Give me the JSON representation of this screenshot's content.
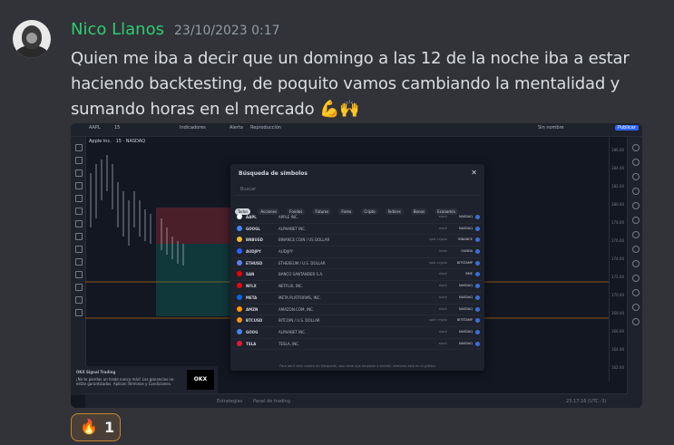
{
  "message": {
    "username": "Nico Llanos",
    "timestamp": "23/10/2023 0:17",
    "text": "Quien me iba a decir que un domingo a las 12 de la noche iba a estar haciendo backtesting, de poquito vamos cambiando la mentalidad y sumando horas en el mercado",
    "emojis": "💪🙌"
  },
  "reaction": {
    "emoji": "🔥",
    "count": "1"
  },
  "screenshot": {
    "toolbar": {
      "symbol": "AAPL",
      "interval": "15",
      "indicators_label": "Indicadores",
      "alert_label": "Alerta",
      "replay_label": "Reproducción",
      "publish_label": "Publicar",
      "unnamed_label": "Sin nombre"
    },
    "chart_title": "Apple Inc. · 15 · NASDAQ",
    "price_levels": [
      "186.00",
      "184.00",
      "182.00",
      "180.00",
      "178.00",
      "176.00",
      "174.00",
      "172.00",
      "170.00",
      "168.00",
      "166.00",
      "164.00",
      "162.00"
    ],
    "fib_labels": [
      "0.618",
      "0.5",
      "0.382",
      "0",
      "1"
    ],
    "time_labels": [
      "4",
      "16",
      "17",
      "18",
      "19",
      "20",
      "24",
      "25",
      "26"
    ],
    "bottom_tabs": [
      "Estrategias",
      "Panel de trading"
    ],
    "bottom_right": "23:17:16 (UTC -3)",
    "ad": {
      "title": "OKX Signal Trading",
      "body": "¡No te pierdas un trade nunca más! Las ganancias no están garantizadas. Aplican Términos y Condiciones.",
      "brand": "OKX"
    },
    "dialog": {
      "title": "Búsqueda de símbolos",
      "search_placeholder": "Buscar",
      "chips": [
        "Todos",
        "Acciones",
        "Fondos",
        "Futuros",
        "Forex",
        "Cripto",
        "Índices",
        "Bonos",
        "Economía"
      ],
      "rows": [
        {
          "symbol": "AAPL",
          "name": "APPLE INC.",
          "type": "stock",
          "exchange": "NASDAQ",
          "color": "#ffffff"
        },
        {
          "symbol": "GOOGL",
          "name": "ALPHABET INC.",
          "type": "stock",
          "exchange": "NASDAQ",
          "color": "#4285f4"
        },
        {
          "symbol": "BNBUSD",
          "name": "BINANCE COIN / US DOLLAR",
          "type": "spot crypto",
          "exchange": "BINANCE",
          "color": "#f3ba2f"
        },
        {
          "symbol": "AUDJPY",
          "name": "AUD/JPY",
          "type": "forex",
          "exchange": "OANDA",
          "color": "#2962ff"
        },
        {
          "symbol": "ETHUSD",
          "name": "ETHEREUM / U.S. DOLLAR",
          "type": "spot crypto",
          "exchange": "BITSTAMP",
          "color": "#627eea"
        },
        {
          "symbol": "SAN",
          "name": "BANCO SANTANDER S.A.",
          "type": "stock",
          "exchange": "BME",
          "color": "#ec0000"
        },
        {
          "symbol": "NFLX",
          "name": "NETFLIX, INC.",
          "type": "stock",
          "exchange": "NASDAQ",
          "color": "#e50914"
        },
        {
          "symbol": "META",
          "name": "META PLATFORMS, INC.",
          "type": "stock",
          "exchange": "NASDAQ",
          "color": "#0668e1"
        },
        {
          "symbol": "AMZN",
          "name": "AMAZON.COM, INC.",
          "type": "stock",
          "exchange": "NASDAQ",
          "color": "#ff9900"
        },
        {
          "symbol": "BTCUSD",
          "name": "BITCOIN / U.S. DOLLAR",
          "type": "spot crypto",
          "exchange": "BITSTAMP",
          "color": "#f7931a"
        },
        {
          "symbol": "GOOG",
          "name": "ALPHABET INC.",
          "type": "stock",
          "exchange": "NASDAQ",
          "color": "#4285f4"
        },
        {
          "symbol": "TSLA",
          "name": "TESLA, INC.",
          "type": "stock",
          "exchange": "NASDAQ",
          "color": "#e31937"
        }
      ],
      "footer": "Para abrir este cuadro de búsqueda, solo tiene que empezar a escribir mientras está en el gráfico"
    }
  }
}
